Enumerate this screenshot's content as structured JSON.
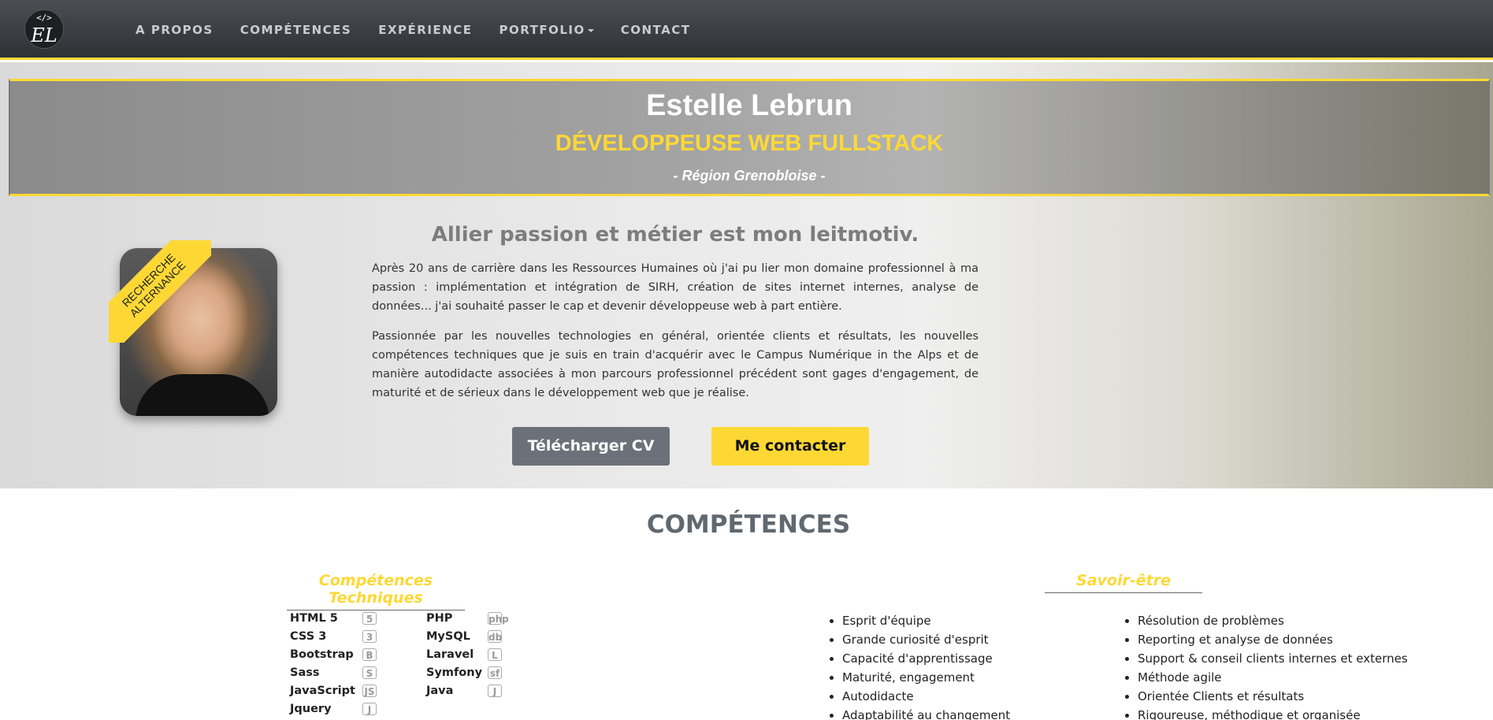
{
  "nav": {
    "logo_code": "</>",
    "logo_monogram": "EL",
    "links": [
      "A PROPOS",
      "COMPÉTENCES",
      "EXPÉRIENCE",
      "PORTFOLIO",
      "CONTACT"
    ]
  },
  "hero": {
    "name": "Estelle Lebrun",
    "role": "DÉVELOPPEUSE WEB FULLSTACK",
    "region": "- Région Grenobloise -",
    "ribbon_line1": "RECHERCHE",
    "ribbon_line2": "ALTERNANCE",
    "headline": "Allier passion et métier est mon leitmotiv.",
    "paragraph1": "Après 20 ans de carrière dans les Ressources Humaines où j'ai pu lier mon domaine professionnel à ma passion : implémentation et intégration de SIRH, création de sites internet internes, analyse de données... j'ai souhaité passer le cap et devenir développeuse web à part entière.",
    "paragraph2": "Passionnée par les nouvelles technologies en général, orientée clients et résultats, les nouvelles compétences techniques que je suis en train d'acquérir avec le Campus Numérique in the Alps et de manière autodidacte associées à mon parcours professionnel précédent sont gages d'engagement, de maturité et de sérieux dans le développement web que je réalise.",
    "btn_cv": "Télécharger CV",
    "btn_contact": "Me contacter"
  },
  "competences": {
    "title": "COMPÉTENCES",
    "tech_title": "Compétences Techniques",
    "savoir_title": "Savoir-être",
    "tech_col1": [
      "HTML 5",
      "CSS 3",
      "Bootstrap",
      "Sass",
      "JavaScript",
      "Jquery"
    ],
    "tech_col1_icons": [
      "5",
      "3",
      "B",
      "S",
      "JS",
      "J"
    ],
    "tech_col2": [
      "PHP",
      "MySQL",
      "Laravel",
      "Symfony",
      "Java"
    ],
    "tech_col2_icons": [
      "php",
      "db",
      "L",
      "sf",
      "J"
    ],
    "soft_col1": [
      "Esprit d'équipe",
      "Grande curiosité d'esprit",
      "Capacité d'apprentissage",
      "Maturité, engagement",
      "Autodidacte",
      "Adaptabilité au changement"
    ],
    "soft_col2": [
      "Résolution de problèmes",
      "Reporting et analyse de données",
      "Support & conseil clients internes et externes",
      "Méthode agile",
      "Orientée Clients et résultats",
      "Rigoureuse, méthodique et organisée"
    ]
  }
}
